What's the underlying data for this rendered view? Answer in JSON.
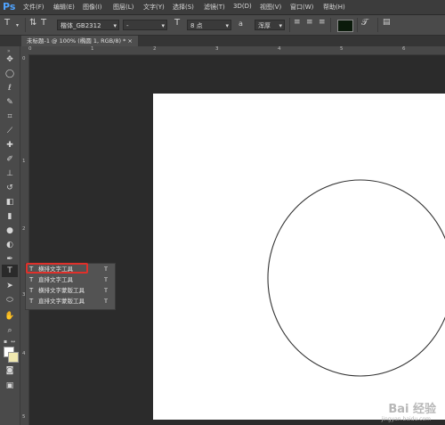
{
  "app": {
    "logo": "Ps"
  },
  "menu": [
    "文件(F)",
    "编辑(E)",
    "图像(I)",
    "图层(L)",
    "文字(Y)",
    "选择(S)",
    "滤镜(T)",
    "3D(D)",
    "视图(V)",
    "窗口(W)",
    "帮助(H)"
  ],
  "options": {
    "tool_icon": "T",
    "font_family": "楷体_GB2312",
    "font_style": "-",
    "size_icon": "T",
    "font_size": "8 点",
    "aa_label": "a",
    "anti_alias": "浑厚",
    "color_swatch": "#0b1a0b"
  },
  "document": {
    "tab_title": "未标题-1 @ 100% (椭圆 1, RGB/8) * ×"
  },
  "rulers": {
    "top_ticks": [
      "0",
      "1",
      "2",
      "3",
      "4",
      "5",
      "6"
    ],
    "left_ticks": [
      "0",
      "1",
      "2",
      "3",
      "4",
      "5"
    ]
  },
  "flyout": {
    "items": [
      {
        "icon": "T",
        "label": "横排文字工具",
        "shortcut": "T"
      },
      {
        "icon": "T",
        "label": "直排文字工具",
        "shortcut": "T"
      },
      {
        "icon": "T",
        "label": "横排文字蒙版工具",
        "shortcut": "T"
      },
      {
        "icon": "T",
        "label": "直排文字蒙版工具",
        "shortcut": "T"
      }
    ]
  },
  "toolbar": {
    "icons": [
      "move-icon",
      "marquee-icon",
      "lasso-icon",
      "quick-select-icon",
      "crop-icon",
      "eyedropper-icon",
      "healing-icon",
      "brush-icon",
      "stamp-icon",
      "history-brush-icon",
      "eraser-icon",
      "gradient-icon",
      "blur-icon",
      "dodge-icon",
      "pen-icon",
      "text-icon",
      "path-select-icon",
      "ellipse-icon",
      "hand-icon",
      "zoom-icon"
    ],
    "text_tool_glyph": "T"
  },
  "watermark": {
    "text": "Bai 经验",
    "sub": "jingyan.baidu.com"
  }
}
